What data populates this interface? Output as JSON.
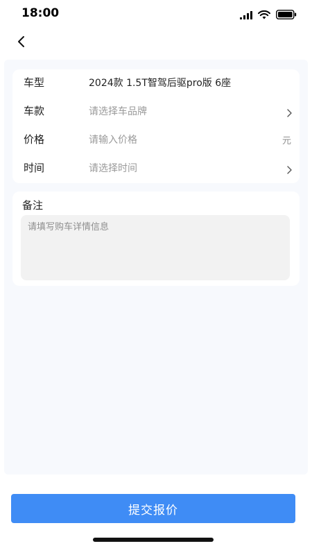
{
  "status_bar": {
    "time": "18:00",
    "icons": [
      "signal-icon",
      "wifi-icon",
      "battery-icon"
    ]
  },
  "nav": {
    "back_icon": "chevron-left-icon"
  },
  "form": {
    "rows": [
      {
        "label": "车型",
        "value": "2024款 1.5T智驾后驱pro版 6座",
        "is_placeholder": false
      },
      {
        "label": "车款",
        "value": "请选择车品牌",
        "is_placeholder": true,
        "trailing": "chevron-right-icon"
      },
      {
        "label": "价格",
        "value": "请输入价格",
        "is_placeholder": true,
        "unit": "元"
      },
      {
        "label": "时间",
        "value": "请选择时间",
        "is_placeholder": true,
        "trailing": "chevron-right-icon"
      }
    ],
    "remark": {
      "label": "备注",
      "placeholder": "请填写购车详情信息",
      "value": ""
    }
  },
  "submit": {
    "label": "提交报价"
  },
  "colors": {
    "accent": "#3f8cf5",
    "page_bg": "#f7f9fd",
    "placeholder": "#9a9a9a"
  }
}
